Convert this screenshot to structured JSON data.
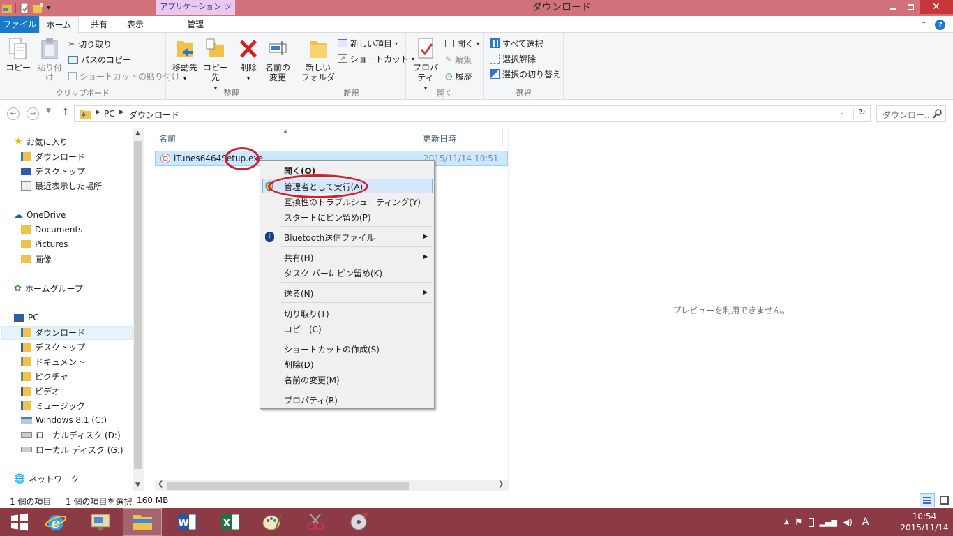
{
  "window": {
    "title": "ダウンロード",
    "context_tab_group": "アプリケーション ツール"
  },
  "tabs": {
    "file": "ファイル",
    "home": "ホーム",
    "share": "共有",
    "view": "表示",
    "manage": "管理"
  },
  "ribbon": {
    "clipboard": {
      "label": "クリップボード",
      "copy": "コピー",
      "paste": "貼り付け",
      "cut": "切り取り",
      "copy_path": "パスのコピー",
      "paste_shortcut": "ショートカットの貼り付け"
    },
    "organize": {
      "label": "整理",
      "move_to": "移動先",
      "copy_to": "コピー先",
      "delete": "削除",
      "rename_line1": "名前の",
      "rename_line2": "変更"
    },
    "new": {
      "label": "新規",
      "new_folder_line1": "新しい",
      "new_folder_line2": "フォルダー",
      "new_item": "新しい項目",
      "shortcut": "ショートカット"
    },
    "open": {
      "label": "開く",
      "properties": "プロパティ",
      "open": "開く",
      "edit": "編集",
      "history": "履歴"
    },
    "select": {
      "label": "選択",
      "select_all": "すべて選択",
      "select_none": "選択解除",
      "invert": "選択の切り替え"
    }
  },
  "address": {
    "crumbs": [
      "PC",
      "ダウンロード"
    ],
    "search_placeholder": "ダウンロー..."
  },
  "nav": {
    "favorites": "お気に入り",
    "fav_items": [
      "ダウンロード",
      "デスクトップ",
      "最近表示した場所"
    ],
    "onedrive": "OneDrive",
    "onedrive_items": [
      "Documents",
      "Pictures",
      "画像"
    ],
    "homegroup": "ホームグループ",
    "pc": "PC",
    "pc_items": [
      "ダウンロード",
      "デスクトップ",
      "ドキュメント",
      "ピクチャ",
      "ビデオ",
      "ミュージック",
      "Windows 8.1 (C:)",
      "ローカルディスク (D:)",
      "ローカル ディスク (G:)"
    ],
    "network": "ネットワーク"
  },
  "filelist": {
    "col_name": "名前",
    "col_date": "更新日時",
    "file": {
      "name": "iTunes6464Setup.exe",
      "date": "2015/11/14 10:51"
    }
  },
  "preview": {
    "text": "プレビューを利用できません。"
  },
  "context_menu": {
    "items": [
      "開く(O)",
      "管理者として実行(A)",
      "互換性のトラブルシューティング(Y)",
      "スタートにピン留め(P)",
      "Bluetooth送信ファイル",
      "共有(H)",
      "タスク バーにピン留め(K)",
      "送る(N)",
      "切り取り(T)",
      "コピー(C)",
      "ショートカットの作成(S)",
      "削除(D)",
      "名前の変更(M)",
      "プロパティ(R)"
    ]
  },
  "status": {
    "count": "1 個の項目",
    "selected": "1 個の項目を選択",
    "size": "160 MB"
  },
  "taskbar": {
    "time": "10:54",
    "date": "2015/11/14",
    "ime": "A"
  },
  "colors": {
    "titlebar": "#d1727a",
    "accent": "#1979ca",
    "taskbar": "#8c3a46",
    "annotation": "#d4202c"
  }
}
